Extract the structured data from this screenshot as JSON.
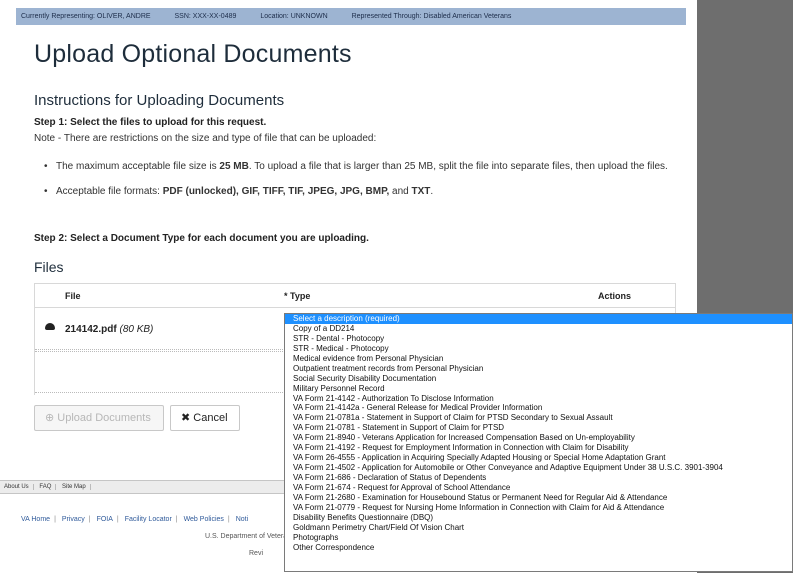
{
  "rep_bar": {
    "representing": "Currently Representing: OLIVER, ANDRE",
    "ssn": "SSN: XXX-XX-0489",
    "location": "Location: UNKNOWN",
    "through": "Represented Through: Disabled American Veterans"
  },
  "title": "Upload Optional Documents",
  "instructions_heading": "Instructions for Uploading Documents",
  "step1": "Step 1: Select the files to upload for this request.",
  "note": "Note - There are restrictions on the size and type of file that can be uploaded:",
  "rule1": {
    "pre": "The maximum acceptable file size is ",
    "bold": "25 MB",
    "post": ". To upload a file that is larger than 25 MB, split the file into separate files, then upload the files."
  },
  "rule2": {
    "pre": "Acceptable file formats: ",
    "formats": "PDF (unlocked), GIF, TIFF, TIF, JPEG, JPG, BMP,",
    "and": " and ",
    "last": "TXT",
    "end": "."
  },
  "step2": "Step 2: Select a Document Type for each document you are uploading.",
  "files_heading": "Files",
  "table": {
    "col_file": "File",
    "col_type": "* Type",
    "col_actions": "Actions",
    "file_name": "214142.pdf",
    "file_size": "(80 KB)"
  },
  "buttons": {
    "upload": "⊕ Upload Documents",
    "cancel": "✖ Cancel"
  },
  "footer_bar": [
    "About Us",
    "FAQ",
    "Site Map"
  ],
  "footer_links": [
    "VA Home",
    "Privacy",
    "FOIA",
    "Facility Locator",
    "Web Policies",
    "Noti"
  ],
  "dept_text": "U.S. Department of Vetera",
  "rev_text": "Revi",
  "type_options": [
    "Select a description (required)",
    "Copy of a DD214",
    "STR - Dental - Photocopy",
    "STR - Medical - Photocopy",
    "Medical evidence from Personal Physician",
    "Outpatient treatment records from Personal Physician",
    "Social Security Disability Documentation",
    "Military Personnel Record",
    "VA Form 21-4142 - Authorization To Disclose Information",
    "VA Form 21-4142a - General Release for Medical Provider Information",
    "VA Form 21-0781a - Statement in Support of Claim for PTSD Secondary to Sexual Assault",
    "VA Form 21-0781 - Statement in Support of Claim for PTSD",
    "VA Form 21-8940 - Veterans Application for Increased Compensation Based on Un-employability",
    "VA Form 21-4192 - Request for Employment Information in Connection with Claim for Disability",
    "VA Form 26-4555 - Application in Acquiring Specially Adapted Housing or Special Home Adaptation Grant",
    "VA Form 21-4502 - Application for Automobile or Other Conveyance and Adaptive Equipment Under 38 U.S.C. 3901-3904",
    "VA Form 21-686 - Declaration of Status of Dependents",
    "VA Form 21-674 - Request for Approval of School Attendance",
    "VA Form 21-2680 - Examination for Housebound Status or Permanent Need for Regular Aid & Attendance",
    "VA Form 21-0779 - Request for Nursing Home Information in Connection with Claim for Aid & Attendance",
    "Disability Benefits Questionnaire (DBQ)",
    "Goldmann Perimetry Chart/Field Of Vision Chart",
    "Photographs",
    "Other Correspondence"
  ],
  "selected_option_index": 0
}
